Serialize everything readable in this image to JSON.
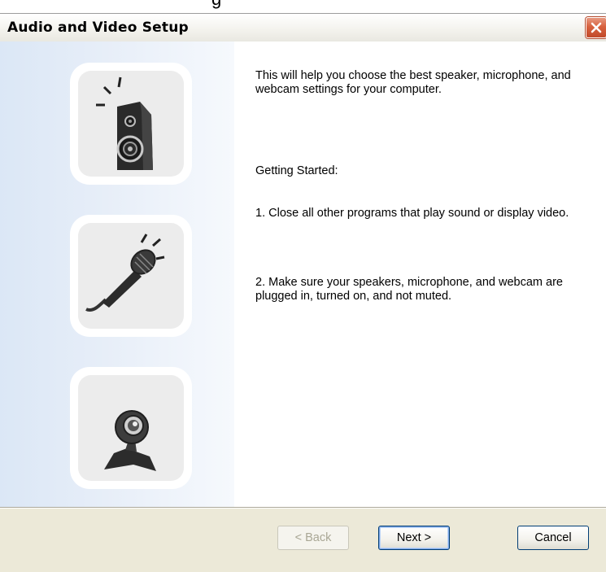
{
  "partial_heading": "g",
  "window": {
    "title": "Audio and Video Setup",
    "close_icon": "close-icon"
  },
  "left_panel": {
    "icons": [
      "speaker-icon",
      "microphone-icon",
      "webcam-icon"
    ]
  },
  "content": {
    "intro": "This will help you choose the best speaker, microphone, and webcam settings for your computer.",
    "heading": "Getting Started:",
    "step1": "1. Close all other programs that play sound or display video.",
    "step2": "2. Make sure your speakers, microphone, and webcam are plugged in, turned on, and not muted."
  },
  "buttons": {
    "back": "< Back",
    "next": "Next >",
    "cancel": "Cancel"
  },
  "colors": {
    "accent_close": "#d8613e",
    "panel_blue": "#dbe7f6",
    "footer": "#ece9d8"
  }
}
